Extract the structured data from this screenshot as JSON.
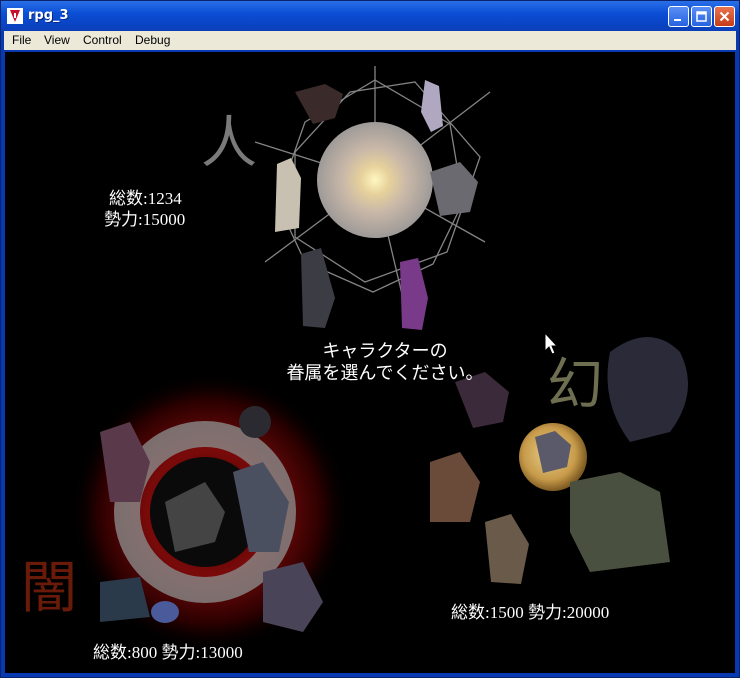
{
  "window": {
    "title": "rpg_3"
  },
  "menu": [
    "File",
    "View",
    "Control",
    "Debug"
  ],
  "factions": {
    "human": {
      "kanji": "人",
      "total": "総数:1234",
      "power": "勢力:15000"
    },
    "illusion": {
      "kanji": "幻",
      "stats": "総数:1500  勢力:20000"
    },
    "dark": {
      "kanji": "闇",
      "stats": "総数:800  勢力:13000"
    }
  },
  "prompt": {
    "line1": "キャラクターの",
    "line2": "眷属を選んでください。"
  },
  "colors": {
    "titlebar": "#0b4fd6",
    "menubar": "#ece9d8",
    "canvas": "#000000",
    "dark_glow": "#8b0000",
    "moon": "#d9b86a"
  }
}
